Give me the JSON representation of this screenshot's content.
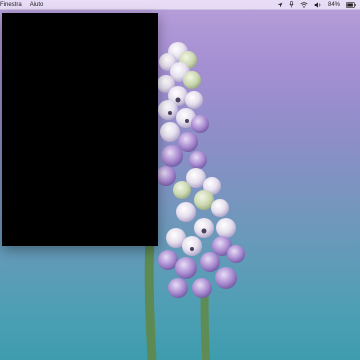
{
  "menubar": {
    "items": [
      "Finestra",
      "Aiuto"
    ],
    "status_icons": [
      "location-arrow-icon",
      "microphone-icon",
      "wifi-icon",
      "volume-icon"
    ],
    "battery_percent": "84%"
  },
  "colors": {
    "menubar_bg": "#ece2f8",
    "window_bg": "#000000",
    "wallpaper_top": "#b79fd9",
    "wallpaper_bottom": "#3e9cae"
  }
}
